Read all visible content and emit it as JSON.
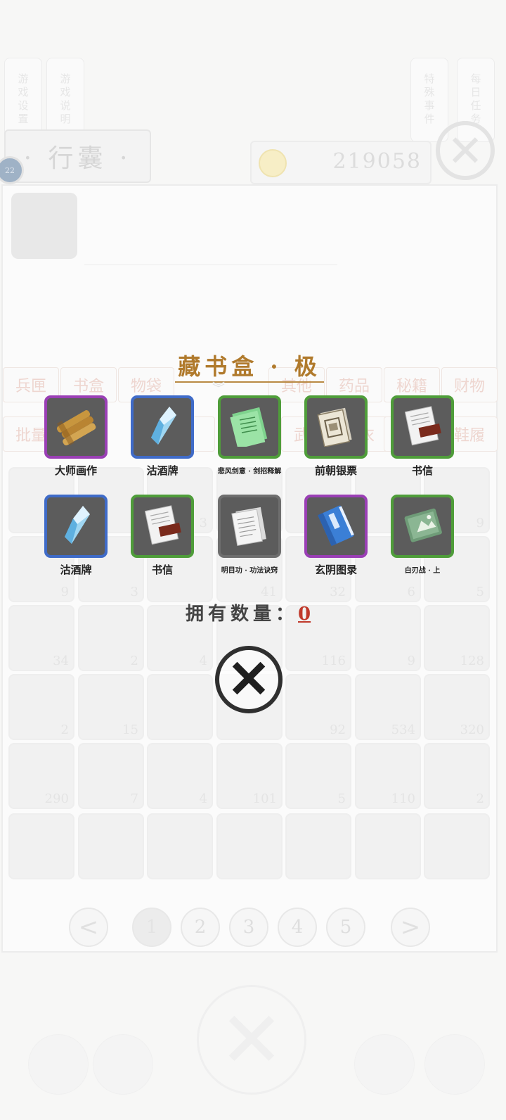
{
  "top_tabs": [
    "游戏设置",
    "游戏说明",
    "特殊事件",
    "每日任务"
  ],
  "bag": {
    "title": "· 行囊 ·",
    "badge": "22"
  },
  "currency": {
    "value": "219058"
  },
  "categories_row1": [
    "兵匣",
    "书盒",
    "物袋",
    "",
    "其他",
    "药品",
    "秘籍",
    "财物"
  ],
  "categories_row2": [
    "批量",
    "",
    "",
    "部",
    "",
    "武器",
    "衣",
    "装",
    "鞋履"
  ],
  "inventory_counts": [
    [
      "5",
      "",
      "3",
      "",
      "",
      "",
      "9"
    ],
    [
      "9",
      "3",
      "",
      "41",
      "32",
      "6",
      "5"
    ],
    [
      "34",
      "2",
      "4",
      "",
      "116",
      "9",
      "128"
    ],
    [
      "2",
      "15",
      "",
      "",
      "92",
      "534",
      "320"
    ],
    [
      "290",
      "7",
      "4",
      "101",
      "5",
      "110",
      "2"
    ],
    [
      "",
      "",
      "",
      "",
      "",
      "",
      ""
    ]
  ],
  "pagination": {
    "pages": [
      "1",
      "2",
      "3",
      "4",
      "5"
    ],
    "current": "1",
    "prev": "<",
    "next": ">"
  },
  "popup": {
    "title": "藏书盒 · 极",
    "owned_label": "拥有数量：",
    "owned_value": "0",
    "rewards": [
      {
        "name": "大师画作",
        "rarity": "purple",
        "icon": "scroll-bundle-icon"
      },
      {
        "name": "沽酒牌",
        "rarity": "blue",
        "icon": "crystal-token-icon"
      },
      {
        "name": "悲风剑意 · 剑招释解",
        "rarity": "green",
        "icon": "green-manual-icon"
      },
      {
        "name": "前朝银票",
        "rarity": "green",
        "icon": "banknote-icon"
      },
      {
        "name": "书信",
        "rarity": "green",
        "icon": "letter-icon"
      },
      {
        "name": "沽酒牌",
        "rarity": "blue",
        "icon": "crystal-token-icon"
      },
      {
        "name": "书信",
        "rarity": "green",
        "icon": "letter-icon"
      },
      {
        "name": "明目功 · 功法诀窍",
        "rarity": "gray",
        "icon": "paper-manual-icon"
      },
      {
        "name": "玄阴图录",
        "rarity": "purple",
        "icon": "blue-book-icon"
      },
      {
        "name": "白刃战 · 上",
        "rarity": "green",
        "icon": "green-book-icon"
      }
    ]
  },
  "colors": {
    "title_gold": "#b07a2c",
    "owned_red": "#c0392b",
    "purple": "#9a3fb5",
    "blue": "#3f6bc8",
    "green": "#4f9d3a"
  }
}
